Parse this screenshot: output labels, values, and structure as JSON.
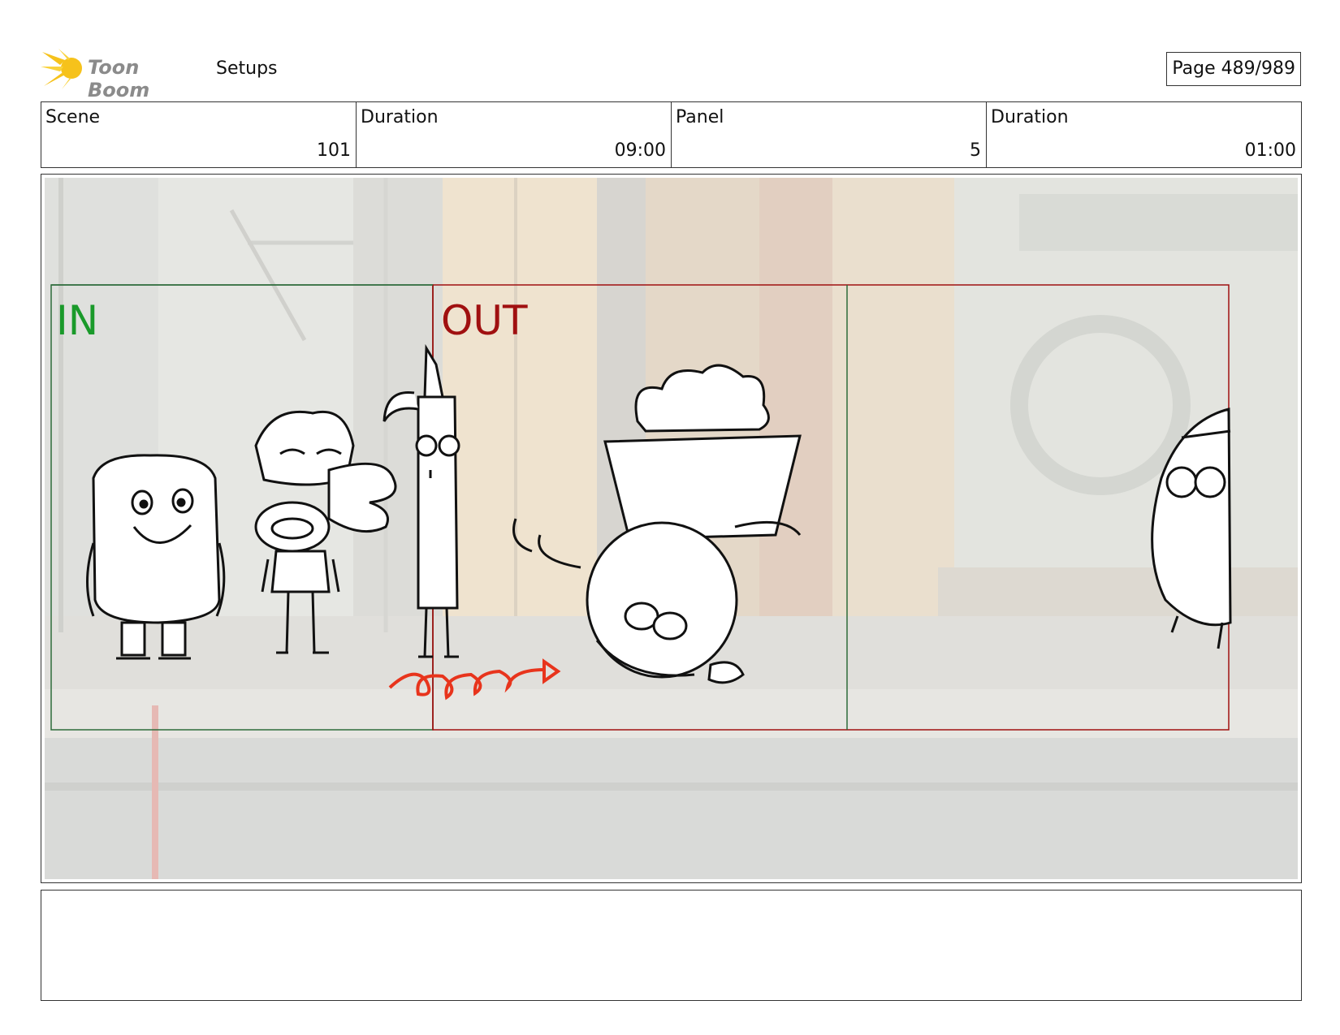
{
  "header": {
    "logo_text": "Toon Boom",
    "title": "Setups",
    "page_label": "Page 489/989"
  },
  "info": [
    {
      "label": "Scene",
      "value": "101"
    },
    {
      "label": "Duration",
      "value": "09:00"
    },
    {
      "label": "Panel",
      "value": "5"
    },
    {
      "label": "Duration",
      "value": "01:00"
    }
  ],
  "panel": {
    "in_label": "IN",
    "out_label": "OUT",
    "in_color": "#1a9a2a",
    "out_color": "#a01010",
    "motion_arrow_color": "#e8341c"
  },
  "notes": {
    "text": ""
  }
}
